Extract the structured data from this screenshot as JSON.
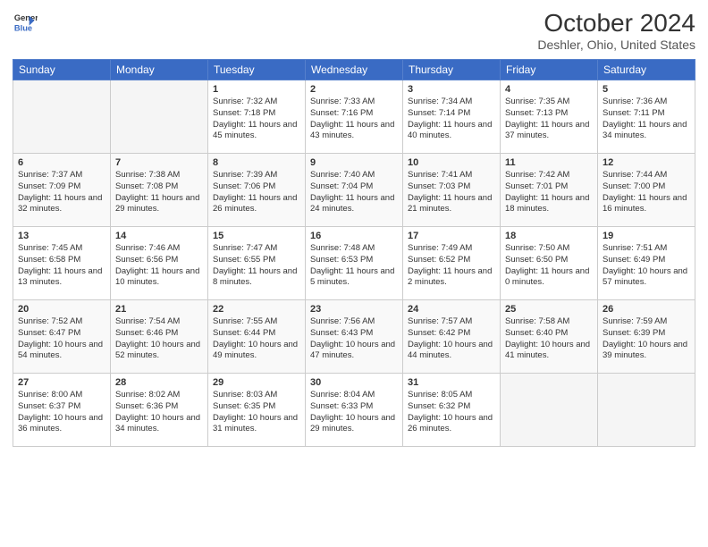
{
  "header": {
    "logo_line1": "General",
    "logo_line2": "Blue",
    "title": "October 2024",
    "subtitle": "Deshler, Ohio, United States"
  },
  "days_of_week": [
    "Sunday",
    "Monday",
    "Tuesday",
    "Wednesday",
    "Thursday",
    "Friday",
    "Saturday"
  ],
  "weeks": [
    [
      {
        "day": "",
        "info": ""
      },
      {
        "day": "",
        "info": ""
      },
      {
        "day": "1",
        "info": "Sunrise: 7:32 AM\nSunset: 7:18 PM\nDaylight: 11 hours and 45 minutes."
      },
      {
        "day": "2",
        "info": "Sunrise: 7:33 AM\nSunset: 7:16 PM\nDaylight: 11 hours and 43 minutes."
      },
      {
        "day": "3",
        "info": "Sunrise: 7:34 AM\nSunset: 7:14 PM\nDaylight: 11 hours and 40 minutes."
      },
      {
        "day": "4",
        "info": "Sunrise: 7:35 AM\nSunset: 7:13 PM\nDaylight: 11 hours and 37 minutes."
      },
      {
        "day": "5",
        "info": "Sunrise: 7:36 AM\nSunset: 7:11 PM\nDaylight: 11 hours and 34 minutes."
      }
    ],
    [
      {
        "day": "6",
        "info": "Sunrise: 7:37 AM\nSunset: 7:09 PM\nDaylight: 11 hours and 32 minutes."
      },
      {
        "day": "7",
        "info": "Sunrise: 7:38 AM\nSunset: 7:08 PM\nDaylight: 11 hours and 29 minutes."
      },
      {
        "day": "8",
        "info": "Sunrise: 7:39 AM\nSunset: 7:06 PM\nDaylight: 11 hours and 26 minutes."
      },
      {
        "day": "9",
        "info": "Sunrise: 7:40 AM\nSunset: 7:04 PM\nDaylight: 11 hours and 24 minutes."
      },
      {
        "day": "10",
        "info": "Sunrise: 7:41 AM\nSunset: 7:03 PM\nDaylight: 11 hours and 21 minutes."
      },
      {
        "day": "11",
        "info": "Sunrise: 7:42 AM\nSunset: 7:01 PM\nDaylight: 11 hours and 18 minutes."
      },
      {
        "day": "12",
        "info": "Sunrise: 7:44 AM\nSunset: 7:00 PM\nDaylight: 11 hours and 16 minutes."
      }
    ],
    [
      {
        "day": "13",
        "info": "Sunrise: 7:45 AM\nSunset: 6:58 PM\nDaylight: 11 hours and 13 minutes."
      },
      {
        "day": "14",
        "info": "Sunrise: 7:46 AM\nSunset: 6:56 PM\nDaylight: 11 hours and 10 minutes."
      },
      {
        "day": "15",
        "info": "Sunrise: 7:47 AM\nSunset: 6:55 PM\nDaylight: 11 hours and 8 minutes."
      },
      {
        "day": "16",
        "info": "Sunrise: 7:48 AM\nSunset: 6:53 PM\nDaylight: 11 hours and 5 minutes."
      },
      {
        "day": "17",
        "info": "Sunrise: 7:49 AM\nSunset: 6:52 PM\nDaylight: 11 hours and 2 minutes."
      },
      {
        "day": "18",
        "info": "Sunrise: 7:50 AM\nSunset: 6:50 PM\nDaylight: 11 hours and 0 minutes."
      },
      {
        "day": "19",
        "info": "Sunrise: 7:51 AM\nSunset: 6:49 PM\nDaylight: 10 hours and 57 minutes."
      }
    ],
    [
      {
        "day": "20",
        "info": "Sunrise: 7:52 AM\nSunset: 6:47 PM\nDaylight: 10 hours and 54 minutes."
      },
      {
        "day": "21",
        "info": "Sunrise: 7:54 AM\nSunset: 6:46 PM\nDaylight: 10 hours and 52 minutes."
      },
      {
        "day": "22",
        "info": "Sunrise: 7:55 AM\nSunset: 6:44 PM\nDaylight: 10 hours and 49 minutes."
      },
      {
        "day": "23",
        "info": "Sunrise: 7:56 AM\nSunset: 6:43 PM\nDaylight: 10 hours and 47 minutes."
      },
      {
        "day": "24",
        "info": "Sunrise: 7:57 AM\nSunset: 6:42 PM\nDaylight: 10 hours and 44 minutes."
      },
      {
        "day": "25",
        "info": "Sunrise: 7:58 AM\nSunset: 6:40 PM\nDaylight: 10 hours and 41 minutes."
      },
      {
        "day": "26",
        "info": "Sunrise: 7:59 AM\nSunset: 6:39 PM\nDaylight: 10 hours and 39 minutes."
      }
    ],
    [
      {
        "day": "27",
        "info": "Sunrise: 8:00 AM\nSunset: 6:37 PM\nDaylight: 10 hours and 36 minutes."
      },
      {
        "day": "28",
        "info": "Sunrise: 8:02 AM\nSunset: 6:36 PM\nDaylight: 10 hours and 34 minutes."
      },
      {
        "day": "29",
        "info": "Sunrise: 8:03 AM\nSunset: 6:35 PM\nDaylight: 10 hours and 31 minutes."
      },
      {
        "day": "30",
        "info": "Sunrise: 8:04 AM\nSunset: 6:33 PM\nDaylight: 10 hours and 29 minutes."
      },
      {
        "day": "31",
        "info": "Sunrise: 8:05 AM\nSunset: 6:32 PM\nDaylight: 10 hours and 26 minutes."
      },
      {
        "day": "",
        "info": ""
      },
      {
        "day": "",
        "info": ""
      }
    ]
  ]
}
